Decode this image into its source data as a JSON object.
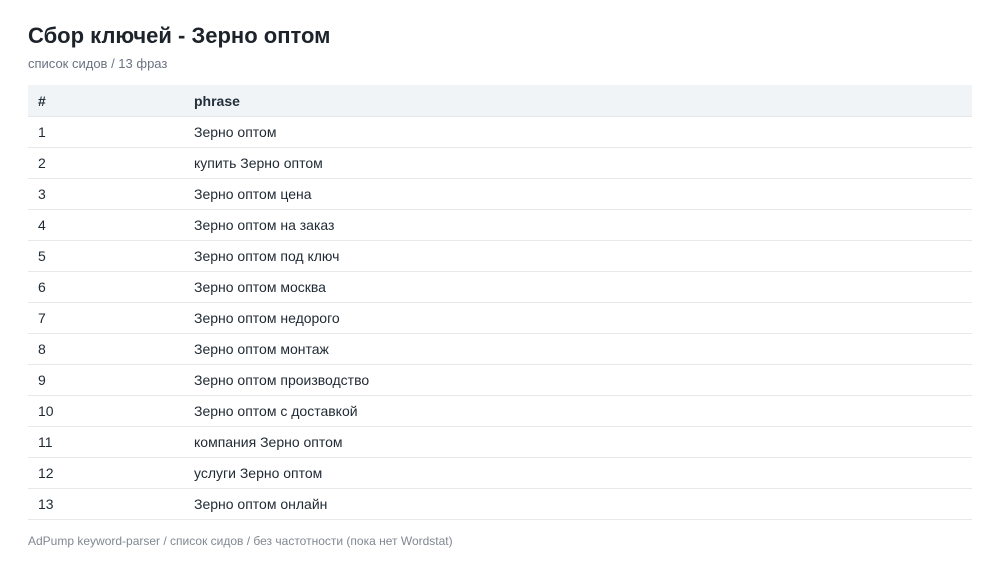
{
  "header": {
    "title": "Сбор ключей - Зерно оптом",
    "subtitle": "список сидов / 13 фраз"
  },
  "table": {
    "columns": [
      "#",
      "phrase"
    ],
    "rows": [
      {
        "num": "1",
        "phrase": "Зерно оптом"
      },
      {
        "num": "2",
        "phrase": "купить Зерно оптом"
      },
      {
        "num": "3",
        "phrase": "Зерно оптом цена"
      },
      {
        "num": "4",
        "phrase": "Зерно оптом на заказ"
      },
      {
        "num": "5",
        "phrase": "Зерно оптом под ключ"
      },
      {
        "num": "6",
        "phrase": "Зерно оптом москва"
      },
      {
        "num": "7",
        "phrase": "Зерно оптом недорого"
      },
      {
        "num": "8",
        "phrase": "Зерно оптом монтаж"
      },
      {
        "num": "9",
        "phrase": "Зерно оптом производство"
      },
      {
        "num": "10",
        "phrase": "Зерно оптом с доставкой"
      },
      {
        "num": "11",
        "phrase": "компания Зерно оптом"
      },
      {
        "num": "12",
        "phrase": "услуги Зерно оптом"
      },
      {
        "num": "13",
        "phrase": "Зерно оптом онлайн"
      }
    ]
  },
  "footer": {
    "text": "AdPump keyword-parser / список сидов / без частотности (пока нет Wordstat)"
  }
}
